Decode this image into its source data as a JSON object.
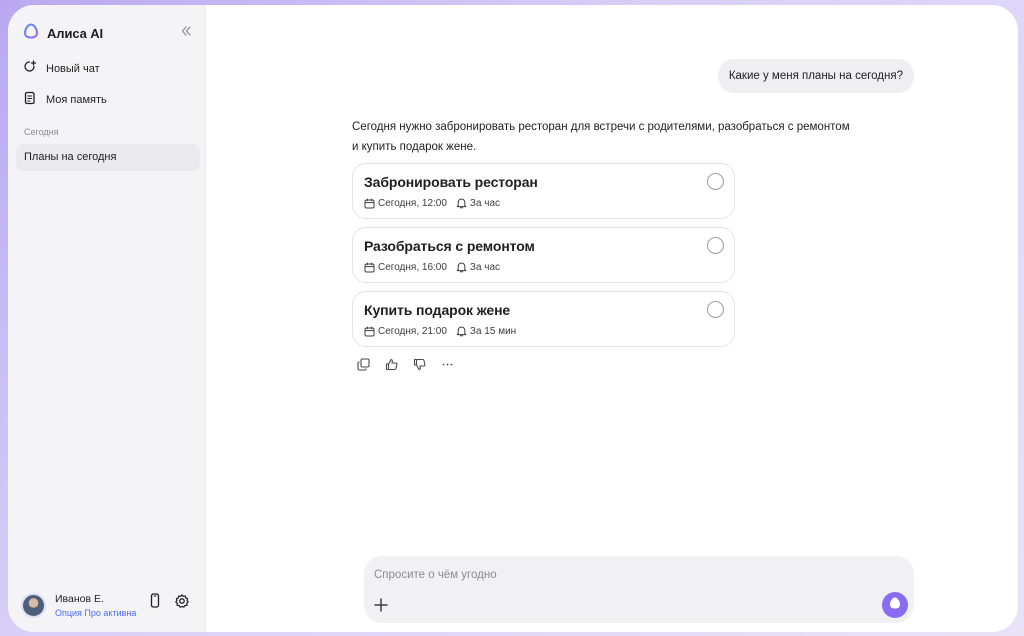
{
  "app": {
    "title": "Алиса AI"
  },
  "sidebar": {
    "new_chat": "Новый чат",
    "memory": "Моя память",
    "section_today": "Сегодня",
    "chats": [
      {
        "label": "Планы на сегодня"
      }
    ]
  },
  "profile": {
    "name": "Иванов Е.",
    "subscription": "Опция Про активна"
  },
  "conversation": {
    "user_message": "Какие у меня планы на сегодня?",
    "assistant_line1": "Сегодня нужно забронировать ресторан для встречи с родителями, разобраться с ремонтом",
    "assistant_line2": "и купить подарок жене.",
    "tasks": [
      {
        "title": "Забронировать ресторан",
        "time": "Сегодня, 12:00",
        "reminder": "За час"
      },
      {
        "title": "Разобраться с ремонтом",
        "time": "Сегодня, 16:00",
        "reminder": "За час"
      },
      {
        "title": "Купить подарок жене",
        "time": "Сегодня, 21:00",
        "reminder": "За 15 мин"
      }
    ]
  },
  "composer": {
    "placeholder": "Спросите о чём угодно",
    "value": ""
  },
  "colors": {
    "accent": "#8a6cf2",
    "link": "#4f6bff",
    "background": "#b9a8f0"
  },
  "icons": {
    "brand": "alisa-logo-icon",
    "collapse": "double-chevron-left-icon",
    "new_chat": "new-chat-icon",
    "memory": "memory-note-icon",
    "phone": "phone-icon",
    "settings": "gear-icon",
    "calendar": "calendar-icon",
    "reminder": "bell-icon",
    "copy": "copy-icon",
    "like": "thumbs-up-icon",
    "dislike": "thumbs-down-icon",
    "more": "more-icon",
    "add": "plus-icon",
    "send": "alisa-send-icon"
  }
}
